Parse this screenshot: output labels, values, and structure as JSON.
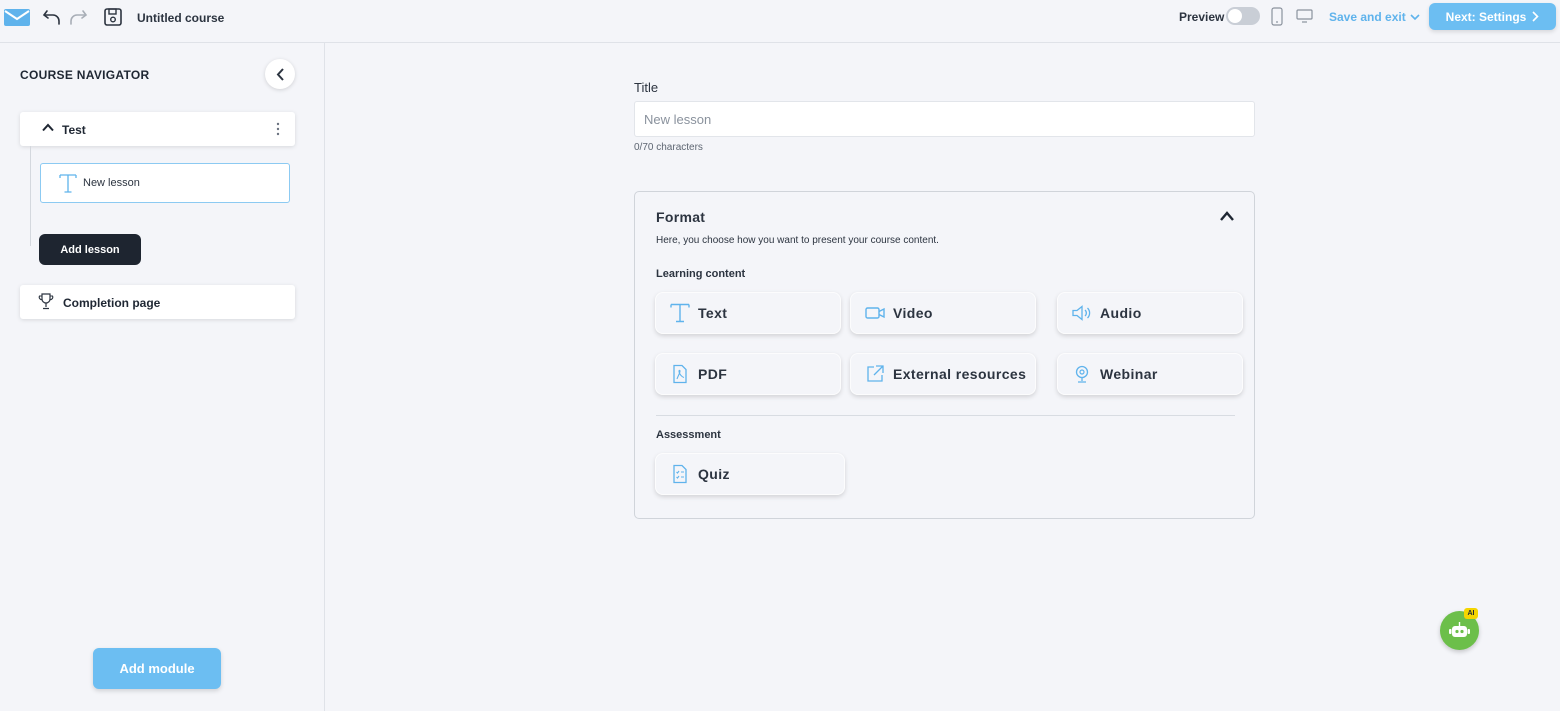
{
  "topbar": {
    "course_title": "Untitled course",
    "preview_label": "Preview",
    "save_exit_label": "Save and exit",
    "next_label": "Next: Settings"
  },
  "sidebar": {
    "title": "COURSE NAVIGATOR",
    "module_name": "Test",
    "lesson_name": "New lesson",
    "add_lesson_label": "Add lesson",
    "completion_label": "Completion page",
    "add_module_label": "Add module"
  },
  "main": {
    "title_label": "Title",
    "title_placeholder": "New lesson",
    "char_count": "0/70 characters",
    "format": {
      "title": "Format",
      "description": "Here, you choose how you want to present your course content.",
      "learning_label": "Learning content",
      "assessment_label": "Assessment",
      "options": [
        {
          "label": "Text",
          "icon": "text-icon"
        },
        {
          "label": "Video",
          "icon": "video-icon"
        },
        {
          "label": "Audio",
          "icon": "audio-icon"
        },
        {
          "label": "PDF",
          "icon": "pdf-icon"
        },
        {
          "label": "External resources",
          "icon": "external-link-icon"
        },
        {
          "label": "Webinar",
          "icon": "webinar-icon"
        }
      ],
      "assessment": [
        {
          "label": "Quiz",
          "icon": "quiz-icon"
        }
      ]
    }
  },
  "ai_badge": "AI",
  "colors": {
    "accent": "#6cbef2",
    "icon_blue": "#5fb3ec",
    "dark_button": "#1e2530",
    "background": "#f4f5f9",
    "bot_green": "#6cbf4a"
  }
}
